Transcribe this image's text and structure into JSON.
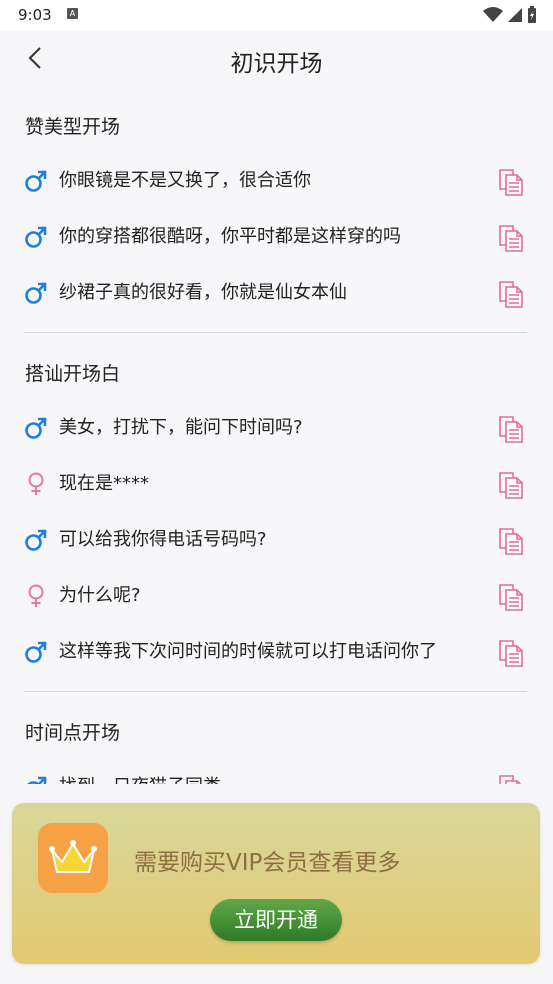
{
  "status": {
    "time": "9:03",
    "badge": "A"
  },
  "nav": {
    "title": "初识开场"
  },
  "sections": [
    {
      "title": "赞美型开场",
      "items": [
        {
          "gender": "male",
          "text": "你眼镜是不是又换了，很合适你"
        },
        {
          "gender": "male",
          "text": "你的穿搭都很酷呀，你平时都是这样穿的吗"
        },
        {
          "gender": "male",
          "text": "纱裙子真的很好看，你就是仙女本仙"
        }
      ]
    },
    {
      "title": "搭讪开场白",
      "items": [
        {
          "gender": "male",
          "text": "美女，打扰下，能问下时间吗?"
        },
        {
          "gender": "female",
          "text": "现在是****"
        },
        {
          "gender": "male",
          "text": "可以给我你得电话号码吗?"
        },
        {
          "gender": "female",
          "text": "为什么呢?"
        },
        {
          "gender": "male",
          "text": "这样等我下次问时间的时候就可以打电话问你了"
        }
      ]
    },
    {
      "title": "时间点开场",
      "items": [
        {
          "gender": "male",
          "text": "找到一只夜猫子同类"
        }
      ]
    }
  ],
  "vip": {
    "message": "需要购买VIP会员查看更多",
    "button": "立即开通"
  },
  "colors": {
    "male": "#1f7fdc",
    "female": "#e877a8",
    "copy": "#e46a9c"
  },
  "icons": {
    "male": "male-gender-icon",
    "female": "female-gender-icon",
    "copy": "copy-icon",
    "back": "back-arrow-icon",
    "crown": "crown-icon"
  }
}
